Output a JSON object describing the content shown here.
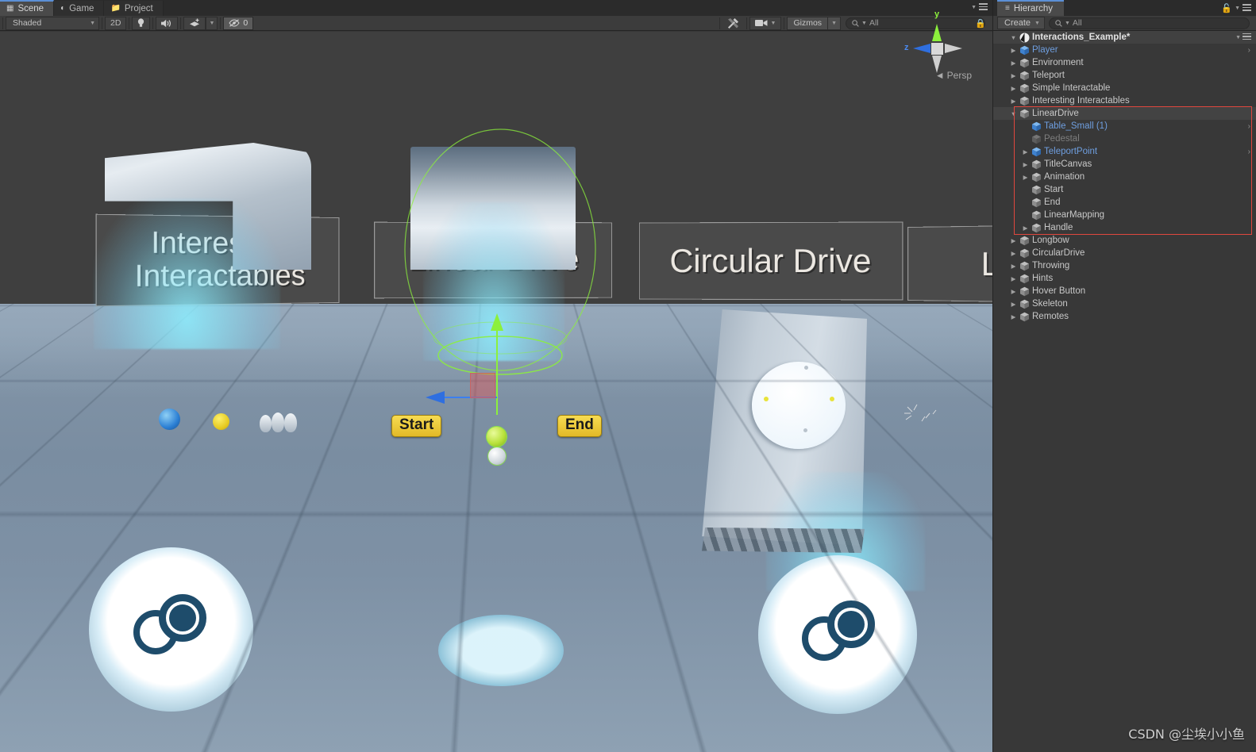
{
  "scene_view": {
    "tabs": [
      {
        "label": "Scene",
        "icon": "grid-icon",
        "active": true
      },
      {
        "label": "Game",
        "icon": "gamepad-icon",
        "active": false
      },
      {
        "label": "Project",
        "icon": "folder-icon",
        "active": false
      }
    ],
    "toolbar": {
      "draw_mode": "Shaded",
      "two_d_toggle": "2D",
      "lighting_icon": "lightbulb-icon",
      "audio_icon": "speaker-icon",
      "fx_icon": "effects-icon",
      "hidden_objects_count": "0",
      "hidden_objects_icon": "eye-off-icon",
      "tools_icon": "tools-icon",
      "camera_icon": "camera-icon",
      "gizmos_label": "Gizmos",
      "search_placeholder": "All",
      "search_value": "All",
      "search_icon": "search-icon"
    },
    "orientation_gizmo": {
      "axis_y": "y",
      "axis_z": "z",
      "projection": "Persp",
      "projection_prefix": "◄"
    },
    "signs": [
      {
        "text": "Interesting\nInteractables"
      },
      {
        "text": "Linear Drive"
      },
      {
        "text": "Circular Drive"
      },
      {
        "text": "L"
      }
    ],
    "gizmo_labels": [
      {
        "text": "Start"
      },
      {
        "text": "End"
      }
    ]
  },
  "hierarchy": {
    "tab_label": "Hierarchy",
    "tab_icon": "hierarchy-icon",
    "create_label": "Create",
    "search_placeholder": "All",
    "search_value": "All",
    "search_icon": "search-icon",
    "lock_icon": "lock-icon",
    "menu_icon": "panel-menu-icon",
    "scene_name": "Interactions_Example*",
    "highlight_color": "#e0473e",
    "prefab_blue": "#6f9fe0",
    "items": [
      {
        "label": "Player",
        "depth": 1,
        "twisty": "collapsed",
        "style": "prefab",
        "chevron": true
      },
      {
        "label": "Environment",
        "depth": 1,
        "twisty": "collapsed",
        "style": "normal",
        "chevron": false
      },
      {
        "label": "Teleport",
        "depth": 1,
        "twisty": "collapsed",
        "style": "normal",
        "chevron": false
      },
      {
        "label": "Simple Interactable",
        "depth": 1,
        "twisty": "collapsed",
        "style": "normal",
        "chevron": false
      },
      {
        "label": "Interesting Interactables",
        "depth": 1,
        "twisty": "collapsed",
        "style": "normal",
        "chevron": false
      },
      {
        "label": "LinearDrive",
        "depth": 1,
        "twisty": "expanded",
        "style": "normal",
        "chevron": false,
        "highlighted": true
      },
      {
        "label": "Table_Small (1)",
        "depth": 2,
        "twisty": "none",
        "style": "prefab",
        "chevron": true
      },
      {
        "label": "Pedestal",
        "depth": 2,
        "twisty": "none",
        "style": "disabled",
        "chevron": false
      },
      {
        "label": "TeleportPoint",
        "depth": 2,
        "twisty": "collapsed",
        "style": "prefab",
        "chevron": true
      },
      {
        "label": "TitleCanvas",
        "depth": 2,
        "twisty": "collapsed",
        "style": "normal",
        "chevron": false
      },
      {
        "label": "Animation",
        "depth": 2,
        "twisty": "collapsed",
        "style": "normal",
        "chevron": false
      },
      {
        "label": "Start",
        "depth": 2,
        "twisty": "none",
        "style": "normal",
        "chevron": false
      },
      {
        "label": "End",
        "depth": 2,
        "twisty": "none",
        "style": "normal",
        "chevron": false
      },
      {
        "label": "LinearMapping",
        "depth": 2,
        "twisty": "none",
        "style": "normal",
        "chevron": false
      },
      {
        "label": "Handle",
        "depth": 2,
        "twisty": "collapsed",
        "style": "normal",
        "chevron": false
      },
      {
        "label": "Longbow",
        "depth": 1,
        "twisty": "collapsed",
        "style": "normal",
        "chevron": false
      },
      {
        "label": "CircularDrive",
        "depth": 1,
        "twisty": "collapsed",
        "style": "normal",
        "chevron": false
      },
      {
        "label": "Throwing",
        "depth": 1,
        "twisty": "collapsed",
        "style": "normal",
        "chevron": false
      },
      {
        "label": "Hints",
        "depth": 1,
        "twisty": "collapsed",
        "style": "normal",
        "chevron": false
      },
      {
        "label": "Hover Button",
        "depth": 1,
        "twisty": "collapsed",
        "style": "normal",
        "chevron": false
      },
      {
        "label": "Skeleton",
        "depth": 1,
        "twisty": "collapsed",
        "style": "normal",
        "chevron": false
      },
      {
        "label": "Remotes",
        "depth": 1,
        "twisty": "collapsed",
        "style": "normal",
        "chevron": false
      }
    ]
  },
  "watermark": {
    "text": "CSDN @尘埃小小鱼"
  }
}
